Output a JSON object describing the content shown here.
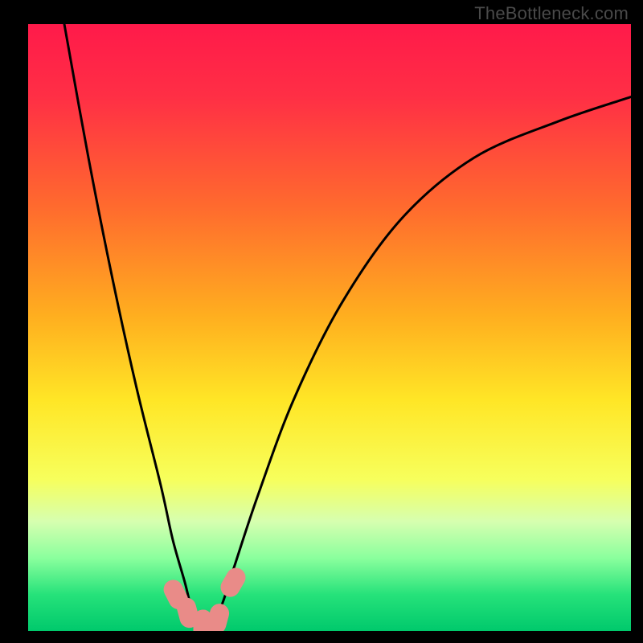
{
  "watermark": "TheBottleneck.com",
  "chart_data": {
    "type": "line",
    "title": "",
    "xlabel": "",
    "ylabel": "",
    "xlim": [
      0,
      100
    ],
    "ylim": [
      0,
      100
    ],
    "background_gradient": {
      "stops": [
        {
          "pct": 0,
          "color": "#ff1a4a"
        },
        {
          "pct": 12,
          "color": "#ff2f45"
        },
        {
          "pct": 30,
          "color": "#ff6a2e"
        },
        {
          "pct": 48,
          "color": "#ffae1f"
        },
        {
          "pct": 62,
          "color": "#ffe626"
        },
        {
          "pct": 75,
          "color": "#f7ff5c"
        },
        {
          "pct": 82,
          "color": "#d6ffb0"
        },
        {
          "pct": 88,
          "color": "#8aff9d"
        },
        {
          "pct": 94,
          "color": "#26e27a"
        },
        {
          "pct": 100,
          "color": "#00c96c"
        }
      ]
    },
    "series": [
      {
        "name": "bottleneck-curve",
        "x": [
          6,
          10,
          14,
          18,
          22,
          24,
          26,
          27,
          28,
          29,
          30,
          32,
          34,
          38,
          44,
          52,
          62,
          74,
          88,
          100
        ],
        "y": [
          100,
          78,
          58,
          40,
          24,
          15,
          8,
          4,
          1,
          0,
          1,
          4,
          10,
          22,
          38,
          54,
          68,
          78,
          84,
          88
        ]
      }
    ],
    "markers": [
      {
        "name": "point-a",
        "x": 24.5,
        "y": 6,
        "color": "#e98b88"
      },
      {
        "name": "point-b",
        "x": 26.5,
        "y": 3,
        "color": "#e98b88"
      },
      {
        "name": "point-c",
        "x": 29.0,
        "y": 1,
        "color": "#e98b88"
      },
      {
        "name": "point-d",
        "x": 31.5,
        "y": 2,
        "color": "#e98b88"
      },
      {
        "name": "point-e",
        "x": 34.0,
        "y": 8,
        "color": "#e98b88"
      }
    ]
  }
}
